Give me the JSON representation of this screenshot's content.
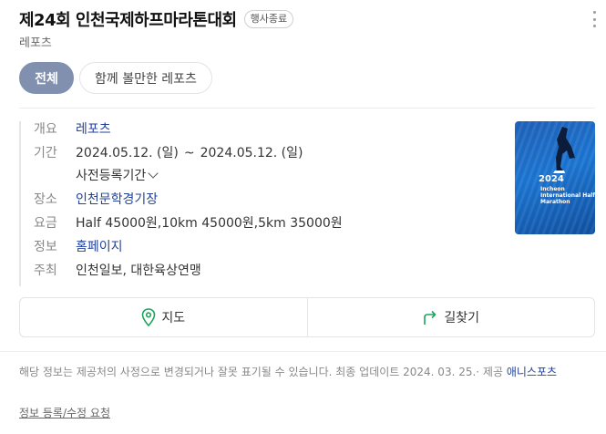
{
  "header": {
    "title": "제24회 인천국제하프마라톤대회",
    "status_badge": "행사종료",
    "category": "레포츠"
  },
  "tabs": [
    {
      "label": "전체",
      "active": true
    },
    {
      "label": "함께 볼만한 레포츠",
      "active": false
    }
  ],
  "info": {
    "overview": {
      "label": "개요",
      "value": "레포츠"
    },
    "period": {
      "label": "기간",
      "start": "2024.05.12. (일)",
      "separator": "~",
      "end": "2024.05.12. (일)",
      "pre_registration": "사전등록기간"
    },
    "place": {
      "label": "장소",
      "value": "인천문학경기장"
    },
    "fee": {
      "label": "요금",
      "value": "Half 45000원,10km 45000원,5km 35000원"
    },
    "info_link": {
      "label": "정보",
      "value": "홈페이지"
    },
    "organizer": {
      "label": "주최",
      "value": "인천일보, 대한육상연맹"
    }
  },
  "poster": {
    "year": "2024",
    "line1": "Incheon",
    "line2": "International Half",
    "line3": "Marathon"
  },
  "actions": {
    "map": "지도",
    "directions": "길찾기"
  },
  "footer": {
    "notice": "해당 정보는 제공처의 사정으로 변경되거나 잘못 표기될 수 있습니다. 최종 업데이트 2024. 03. 25.· 제공",
    "provider": "애니스포츠",
    "report": "정보 등록/수정 요청"
  },
  "colors": {
    "active_tab": "#8290b0",
    "link": "#23429a",
    "map_icon": "#19a55b"
  }
}
